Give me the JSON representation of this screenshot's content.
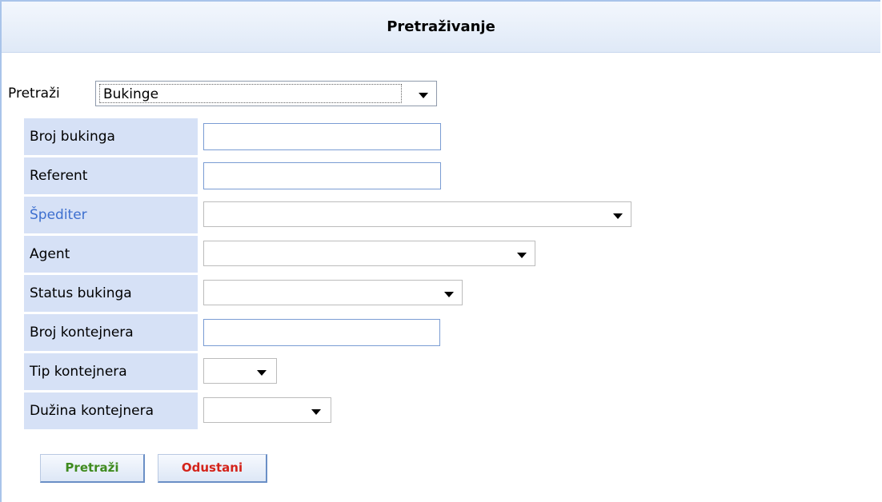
{
  "panel": {
    "title": "Pretraživanje"
  },
  "search": {
    "label": "Pretraži",
    "selected_value": "Bukinge"
  },
  "form": {
    "fields": [
      {
        "label": "Broj bukinga",
        "type": "text",
        "value": ""
      },
      {
        "label": "Referent",
        "type": "text",
        "value": ""
      },
      {
        "label": "Špediter",
        "type": "select",
        "value": "",
        "link": true
      },
      {
        "label": "Agent",
        "type": "select",
        "value": ""
      },
      {
        "label": "Status bukinga",
        "type": "select",
        "value": ""
      },
      {
        "label": "Broj kontejnera",
        "type": "text",
        "value": ""
      },
      {
        "label": "Tip kontejnera",
        "type": "select",
        "value": ""
      },
      {
        "label": "Dužina kontejnera",
        "type": "select",
        "value": ""
      }
    ]
  },
  "buttons": {
    "search_label": "Pretraži",
    "cancel_label": "Odustani"
  },
  "colors": {
    "label_bg": "#d6e1f6",
    "link_label": "#3d6fcf",
    "search_button_text": "#3f8b1f",
    "cancel_button_text": "#d4231a"
  }
}
